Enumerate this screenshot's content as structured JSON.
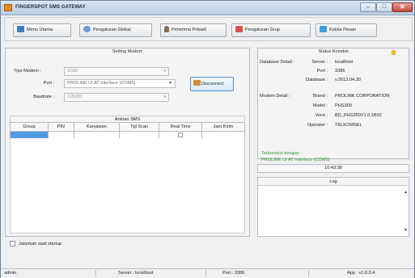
{
  "window": {
    "title": "FINGERSPOT SMS GATEWAY",
    "controls": {
      "minimize": "–",
      "maximize": "□",
      "close": "✕"
    }
  },
  "toolbar": {
    "items": [
      {
        "label": "Menu Utama",
        "icon": "home-icon",
        "color": "#3c7fc4"
      },
      {
        "label": "Pengaturan Global",
        "icon": "gear-globe-icon",
        "color": "#6a9fd6"
      },
      {
        "label": "Penerima Pribadi",
        "icon": "person-icon",
        "color": "#8a6a4a"
      },
      {
        "label": "Pengaturan Grup",
        "icon": "group-icon",
        "color": "#d9534f"
      },
      {
        "label": "Kelola Pesan",
        "icon": "message-icon",
        "color": "#3fa0d8"
      }
    ]
  },
  "modem_settings": {
    "title": "Setting Modem",
    "tipe_modem": {
      "label": "Tipe Modem :",
      "value": "GSM"
    },
    "port": {
      "label": "Port :",
      "value": "PROLINK UI AT Interface (COM5)"
    },
    "baudrate": {
      "label": "Baudrate :",
      "value": "115200"
    },
    "disconnect_label": "Disconnect"
  },
  "queue": {
    "title": "Antrian SMS",
    "columns": [
      "Group",
      "PIN",
      "Karyawan",
      "Tgl Scan",
      "Real Time",
      "Jam Kirim"
    ]
  },
  "startup": {
    "label": "Jalankan saat startup",
    "checked": false
  },
  "connection_status": {
    "title": "Status Koneksi",
    "database_label": "Database Detail :",
    "server_label": "Server :",
    "server": "localhost",
    "port_label": "Port :",
    "port": "3386",
    "database_name_label": "Database :",
    "database": "v.2013.04.30",
    "modem_label": "Modem Detail :",
    "brand_label": "Brand :",
    "brand": "PROLINK CORPORATION",
    "model_label": "Model :",
    "model": "PHS300",
    "version_label": "Versi :",
    "version": "BD_PHS300V1.0.1B02",
    "operator_label": "Operator :",
    "operator": "TELKOMSEL",
    "connected_line1": "Terkoneksi dengan :",
    "connected_line2": "PROLINK UI AT Interface (COM5)",
    "status_color": "#2c9a2c"
  },
  "clock": "10:43:38",
  "log": {
    "title": "Log"
  },
  "statusbar": {
    "user": "admin",
    "server": "Server : localhost",
    "port": "Port : 3386",
    "app": "App : v1.0.0.4"
  }
}
